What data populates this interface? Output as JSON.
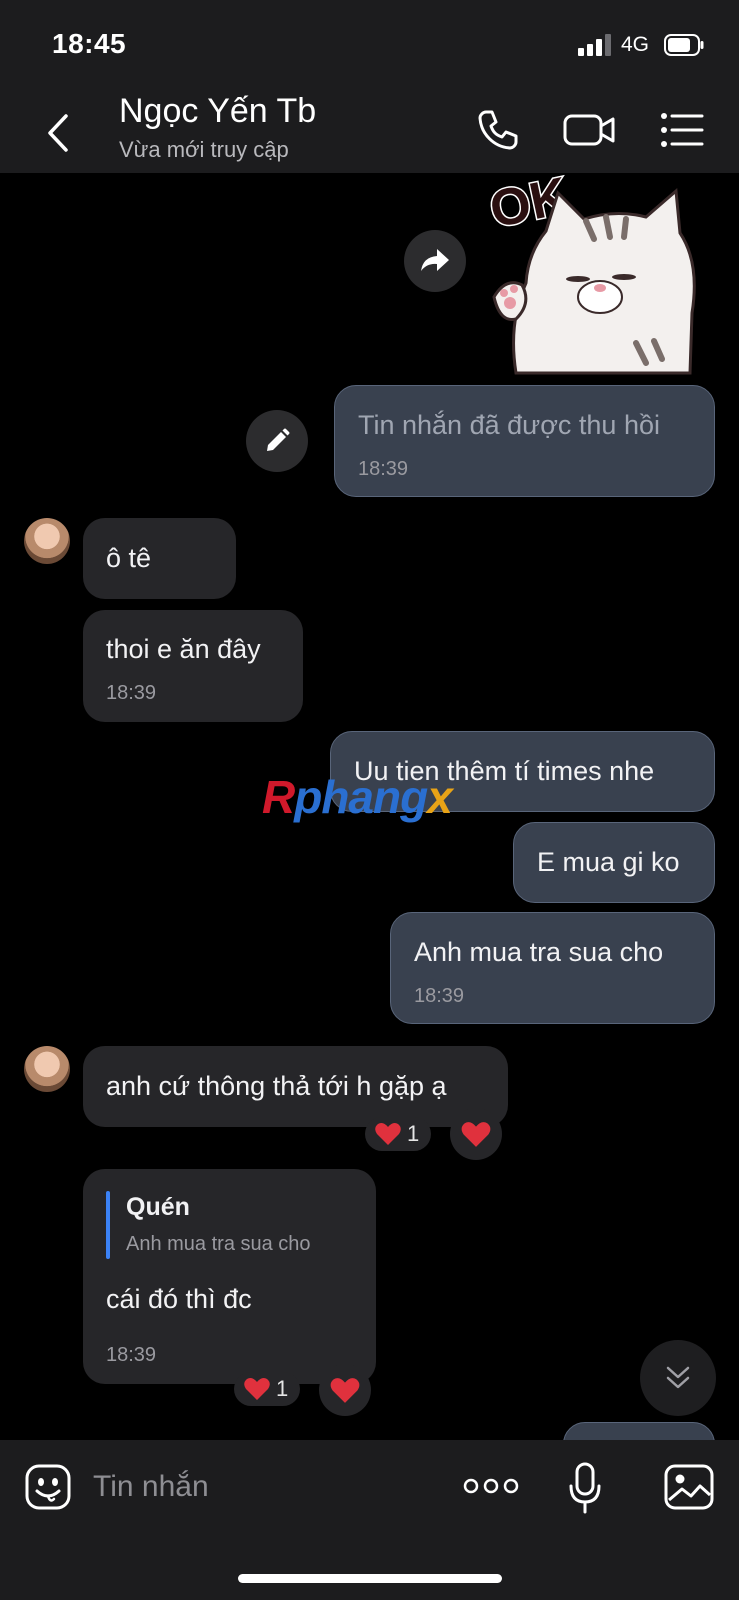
{
  "status_bar": {
    "time": "18:45",
    "network": "4G"
  },
  "header": {
    "contact_name": "Ngọc Yến Tb",
    "contact_status": "Vừa mới truy cập"
  },
  "sticker": {
    "caption": "OK"
  },
  "messages": {
    "recalled": {
      "text": "Tin nhắn đã được thu hồi",
      "time": "18:39"
    },
    "in1": {
      "text": "ô tê"
    },
    "in2": {
      "text": "thoi e ăn đây",
      "time": "18:39"
    },
    "out1": {
      "text": "Uu tien thêm tí times nhe"
    },
    "out2": {
      "text": "E mua gi ko"
    },
    "out3": {
      "text": "Anh mua tra sua cho",
      "time": "18:39"
    },
    "in3": {
      "text": "anh cứ thông thả tới h gặp ạ",
      "reaction_count": "1"
    },
    "in4": {
      "quote_author": "Quén",
      "quote_text": "Anh mua tra sua cho",
      "text": "cái đó thì đc",
      "time": "18:39",
      "reaction_count": "1"
    }
  },
  "watermark": {
    "part1": "R",
    "part2": "phang",
    "part3": "x"
  },
  "composer": {
    "placeholder": "Tin nhắn"
  },
  "icons": [
    "back-chevron-icon",
    "phone-icon",
    "video-call-icon",
    "list-menu-icon",
    "forward-icon",
    "edit-pencil-icon",
    "heart-icon",
    "scroll-down-icon",
    "emoji-sticker-icon",
    "more-dots-icon",
    "microphone-icon",
    "image-gallery-icon"
  ],
  "colors": {
    "outgoing_bubble": "#39414f",
    "incoming_bubble": "#262629",
    "reaction_heart": "#e0313d"
  }
}
